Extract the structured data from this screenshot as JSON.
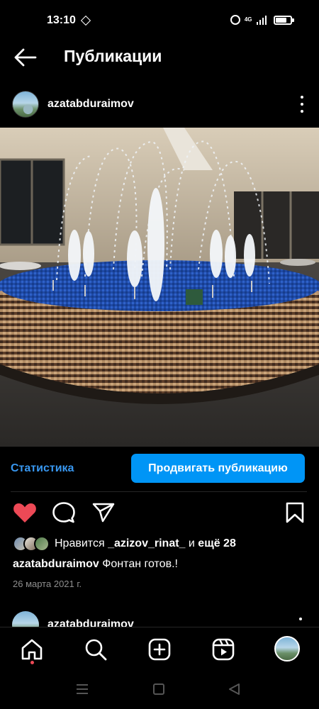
{
  "status_bar": {
    "time": "13:10",
    "network": "4G",
    "battery_level": 0.75,
    "icons": [
      "diamond-icon",
      "alarm-icon",
      "signal-icon",
      "battery-icon"
    ]
  },
  "header": {
    "title": "Публикации",
    "back_icon": "arrow-left-icon"
  },
  "post": {
    "username": "azatabduraimov",
    "menu_icon": "more-vertical-icon",
    "image_icon": "fountain-photo",
    "stats_link": "Статистика",
    "promote_button": "Продвигать публикацию",
    "actions": [
      "heart-filled-icon",
      "comment-icon",
      "share-icon",
      "bookmark-icon"
    ],
    "liked": true,
    "likes": {
      "prefix": "Нравится",
      "user": "_azizov_rinat_",
      "middle": "и",
      "rest": "ещё 28"
    },
    "caption_user": "azatabduraimov",
    "caption_text": "Фонтан готов.!",
    "date": "26 марта 2021 г."
  },
  "next_post": {
    "username": "azatabduraimov"
  },
  "bottom_nav": {
    "items": [
      "home-icon",
      "search-icon",
      "new-post-icon",
      "reels-icon",
      "profile-avatar"
    ],
    "has_notification": true
  },
  "system_nav": {
    "items": [
      "menu-icon",
      "home-square-icon",
      "back-triangle-icon"
    ]
  },
  "colors": {
    "accent": "#0095f6",
    "link": "#3897f0",
    "like": "#ed4956",
    "background": "#000000",
    "muted": "#8e8e8e"
  }
}
